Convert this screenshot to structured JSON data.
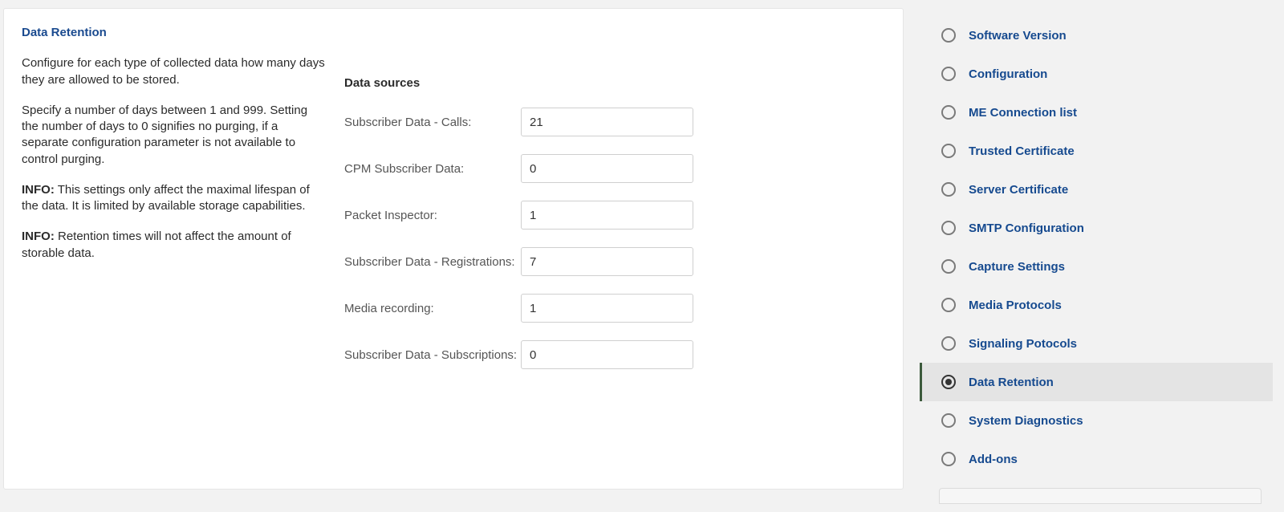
{
  "main": {
    "title": "Data Retention",
    "paragraph1": "Configure for each type of collected data how many days they are allowed to be stored.",
    "paragraph2": "Specify a number of days between 1 and 999. Setting the number of days to 0 signifies no purging, if a separate configuration parameter is not available to control purging.",
    "info1_label": "INFO:",
    "info1_text": " This settings only affect the maximal lifespan of the data. It is limited by available storage capabilities.",
    "info2_label": "INFO:",
    "info2_text": " Retention times will not affect the amount of storable data.",
    "form_heading": "Data sources",
    "fields": {
      "subscriber_calls": {
        "label": "Subscriber Data - Calls:",
        "value": "21"
      },
      "cpm_subscriber": {
        "label": "CPM Subscriber Data:",
        "value": "0"
      },
      "packet_inspector": {
        "label": "Packet Inspector:",
        "value": "1"
      },
      "subscriber_reg": {
        "label": "Subscriber Data - Registrations:",
        "value": "7"
      },
      "media_recording": {
        "label": "Media recording:",
        "value": "1"
      },
      "subscriber_subs": {
        "label": "Subscriber Data - Subscriptions:",
        "value": "0"
      }
    }
  },
  "nav": {
    "items": [
      {
        "label": "Software Version",
        "selected": false
      },
      {
        "label": "Configuration",
        "selected": false
      },
      {
        "label": "ME Connection list",
        "selected": false
      },
      {
        "label": "Trusted Certificate",
        "selected": false
      },
      {
        "label": "Server Certificate",
        "selected": false
      },
      {
        "label": "SMTP Configuration",
        "selected": false
      },
      {
        "label": "Capture Settings",
        "selected": false
      },
      {
        "label": "Media Protocols",
        "selected": false
      },
      {
        "label": "Signaling Potocols",
        "selected": false
      },
      {
        "label": "Data Retention",
        "selected": true
      },
      {
        "label": "System Diagnostics",
        "selected": false
      },
      {
        "label": "Add-ons",
        "selected": false
      }
    ]
  }
}
